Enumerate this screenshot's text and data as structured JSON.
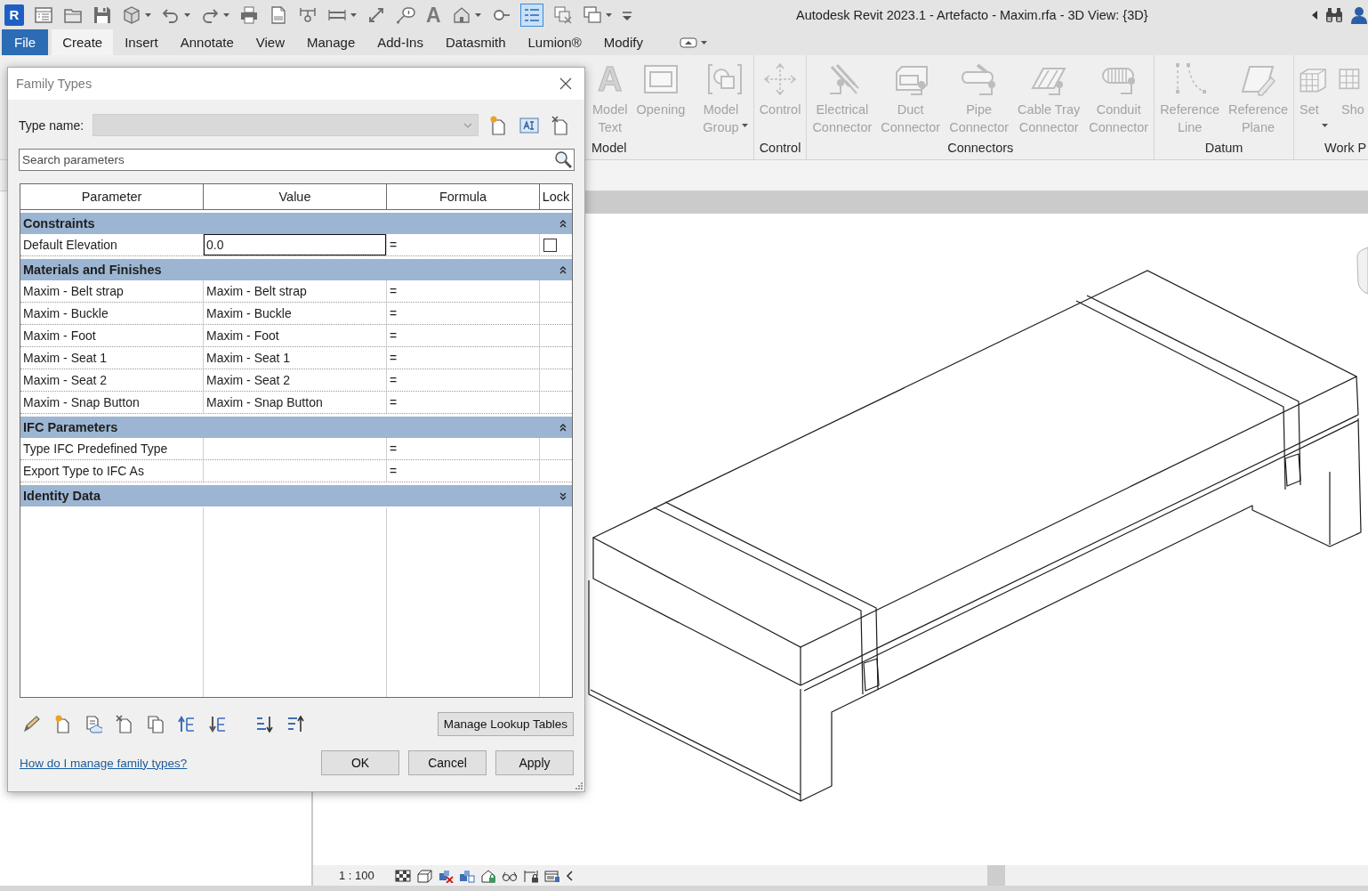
{
  "window": {
    "app_logo": "R",
    "title": "Autodesk Revit 2023.1 - Artefacto - Maxim.rfa - 3D View: {3D}"
  },
  "quick_access_toolbar": {
    "glyph_button": "A",
    "toggle": {
      "on": true
    }
  },
  "ribbon_tabs": [
    {
      "label": "File",
      "kind": "file",
      "selected": false
    },
    {
      "label": "Create",
      "kind": "tab",
      "selected": true
    },
    {
      "label": "Insert",
      "kind": "tab",
      "selected": false
    },
    {
      "label": "Annotate",
      "kind": "tab",
      "selected": false
    },
    {
      "label": "View",
      "kind": "tab",
      "selected": false
    },
    {
      "label": "Manage",
      "kind": "tab",
      "selected": false
    },
    {
      "label": "Add-Ins",
      "kind": "tab",
      "selected": false
    },
    {
      "label": "Datasmith",
      "kind": "tab",
      "selected": false
    },
    {
      "label": "Lumion®",
      "kind": "tab",
      "selected": false
    },
    {
      "label": "Modify",
      "kind": "tab",
      "selected": false
    }
  ],
  "ribbon_panels": [
    {
      "label": "Model",
      "buttons": [
        {
          "label": "Model\nText",
          "glyph": "A",
          "disabled": true,
          "dropdown": false
        },
        {
          "label": "Opening",
          "disabled": true,
          "dropdown": false
        },
        {
          "label": "Model\nGroup",
          "disabled": true,
          "dropdown": true
        }
      ]
    },
    {
      "label": "Control",
      "buttons": [
        {
          "label": "Control",
          "disabled": true,
          "dropdown": false
        }
      ]
    },
    {
      "label": "Connectors",
      "buttons": [
        {
          "label": "Electrical\nConnector",
          "disabled": true,
          "dropdown": false
        },
        {
          "label": "Duct\nConnector",
          "disabled": true,
          "dropdown": false
        },
        {
          "label": "Pipe\nConnector",
          "disabled": true,
          "dropdown": false
        },
        {
          "label": "Cable Tray\nConnector",
          "disabled": true,
          "dropdown": false
        },
        {
          "label": "Conduit\nConnector",
          "disabled": true,
          "dropdown": false
        }
      ]
    },
    {
      "label": "Datum",
      "buttons": [
        {
          "label": "Reference\nLine",
          "disabled": true,
          "dropdown": false
        },
        {
          "label": "Reference\nPlane",
          "disabled": true,
          "dropdown": false
        }
      ]
    },
    {
      "label": "Work P",
      "buttons": [
        {
          "label": "Set",
          "disabled": true,
          "dropdown": true
        },
        {
          "label": "Sho",
          "disabled": true,
          "dropdown": false
        }
      ]
    }
  ],
  "status_bar": {
    "scale": "1 : 100"
  },
  "dialog": {
    "title": "Family Types",
    "type_name": {
      "label": "Type name:",
      "disabled": true
    },
    "search": {
      "placeholder": "Search parameters"
    },
    "table": {
      "columns": [
        "Parameter",
        "Value",
        "Formula",
        "Lock"
      ],
      "groups": [
        {
          "title": "Constraints",
          "expanded": true,
          "rows": [
            {
              "parameter": "Default Elevation",
              "value": "0.0",
              "formula": "=",
              "editing": true,
              "lock": {
                "checked": false
              }
            }
          ]
        },
        {
          "title": "Materials and Finishes",
          "expanded": true,
          "rows": [
            {
              "parameter": "Maxim - Belt strap",
              "value": "Maxim - Belt strap",
              "formula": "=",
              "editing": false
            },
            {
              "parameter": "Maxim - Buckle",
              "value": "Maxim - Buckle",
              "formula": "=",
              "editing": false
            },
            {
              "parameter": "Maxim - Foot",
              "value": "Maxim - Foot",
              "formula": "=",
              "editing": false
            },
            {
              "parameter": "Maxim - Seat 1",
              "value": "Maxim - Seat 1",
              "formula": "=",
              "editing": false
            },
            {
              "parameter": "Maxim - Seat 2",
              "value": "Maxim - Seat 2",
              "formula": "=",
              "editing": false
            },
            {
              "parameter": "Maxim - Snap Button",
              "value": "Maxim - Snap Button",
              "formula": "=",
              "editing": false
            }
          ]
        },
        {
          "title": "IFC Parameters",
          "expanded": true,
          "rows": [
            {
              "parameter": "Type IFC Predefined Type",
              "formula": "=",
              "editing": false
            },
            {
              "parameter": "Export Type to IFC As",
              "formula": "=",
              "editing": false
            }
          ]
        },
        {
          "title": "Identity Data",
          "expanded": false
        }
      ]
    },
    "lookup_button": "Manage Lookup Tables",
    "help_link": "How do I manage family types?",
    "buttons": [
      "OK",
      "Cancel",
      "Apply"
    ]
  }
}
